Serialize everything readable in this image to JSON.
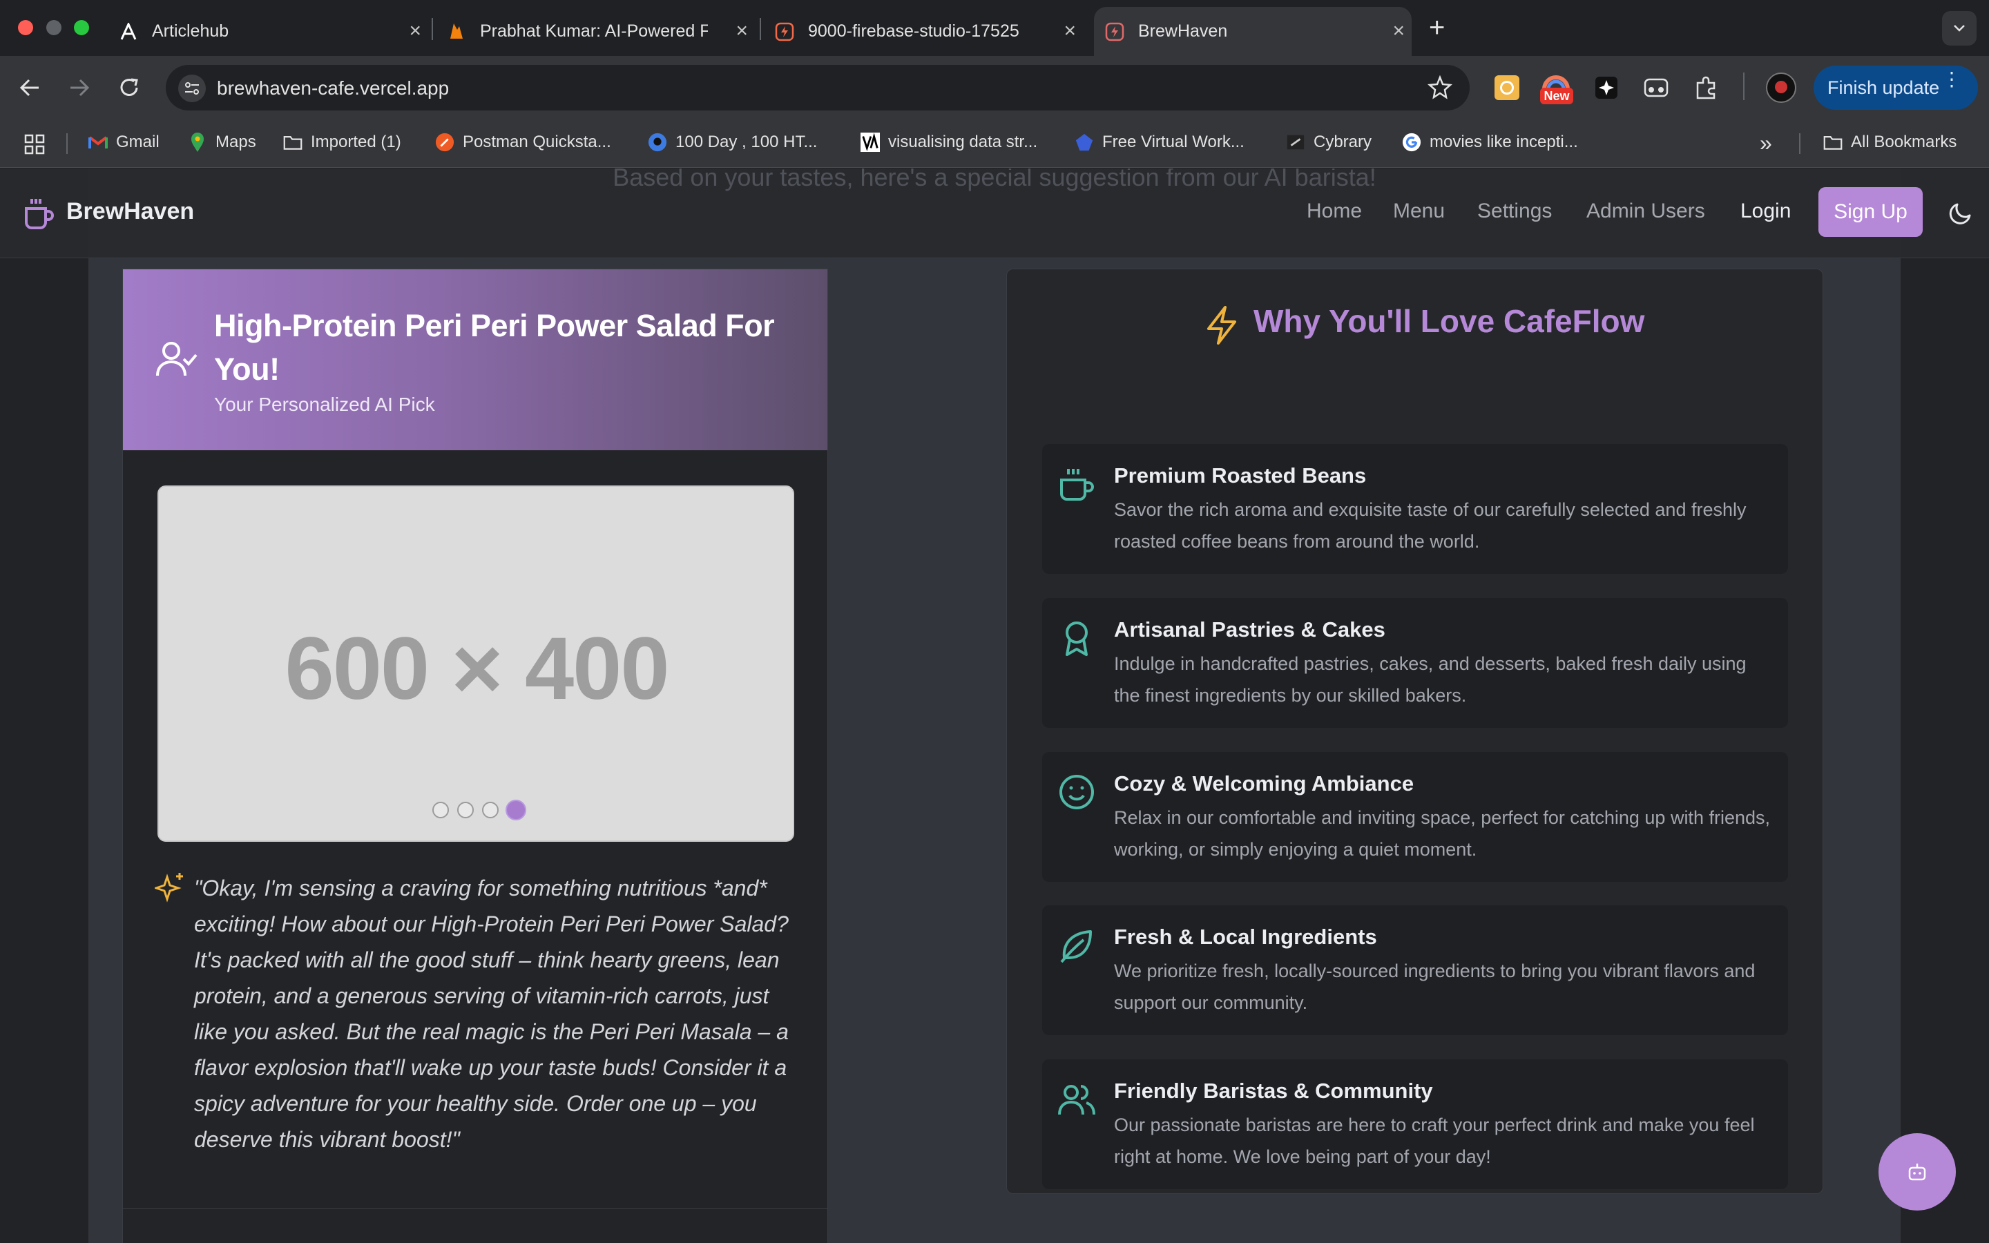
{
  "browser": {
    "tabs": [
      {
        "title": "Articlehub"
      },
      {
        "title": "Prabhat Kumar: AI-Powered F"
      },
      {
        "title": "9000-firebase-studio-17525"
      },
      {
        "title": "BrewHaven"
      }
    ],
    "address": "brewhaven-cafe.vercel.app",
    "new_badge": "New",
    "finish_update": "Finish update",
    "bookmarks": [
      {
        "label": "Gmail"
      },
      {
        "label": "Maps"
      },
      {
        "label": "Imported (1)"
      },
      {
        "label": "Postman Quicksta..."
      },
      {
        "label": "100 Day , 100 HT..."
      },
      {
        "label": "visualising data str..."
      },
      {
        "label": "Free Virtual Work..."
      },
      {
        "label": "Cybrary"
      },
      {
        "label": "movies like incepti..."
      }
    ],
    "all_bookmarks": "All Bookmarks"
  },
  "site": {
    "brand": "BrewHaven",
    "nav": [
      "Home",
      "Menu",
      "Settings",
      "Admin Users"
    ],
    "login": "Login",
    "signup": "Sign Up",
    "ghost_text": "Based on your tastes, here's a special suggestion from our AI barista!",
    "accent": "#b688d8"
  },
  "recommendation": {
    "title": "High-Protein Peri Peri Power Salad For You!",
    "subtitle": "Your Personalized AI Pick",
    "image_placeholder": "600 × 400",
    "carousel": {
      "total": 4,
      "active": 4
    },
    "quote": "\"Okay, I'm sensing a craving for something nutritious *and* exciting! How about our High-Protein Peri Peri Power Salad? It's packed with all the good stuff – think hearty greens, lean protein, and a generous serving of vitamin-rich carrots, just like you asked. But the real magic is the Peri Peri Masala – a flavor explosion that'll wake up your taste buds! Consider it a spicy adventure for your healthy side. Order one up – you deserve this vibrant boost!\""
  },
  "why": {
    "title": "Why You'll Love CafeFlow",
    "features": [
      {
        "icon": "coffee-cup-icon",
        "title": "Premium Roasted Beans",
        "desc": "Savor the rich aroma and exquisite taste of our carefully selected and freshly roasted coffee beans from around the world."
      },
      {
        "icon": "award-icon",
        "title": "Artisanal Pastries & Cakes",
        "desc": "Indulge in handcrafted pastries, cakes, and desserts, baked fresh daily using the finest ingredients by our skilled bakers."
      },
      {
        "icon": "smile-icon",
        "title": "Cozy & Welcoming Ambiance",
        "desc": "Relax in our comfortable and inviting space, perfect for catching up with friends, working, or simply enjoying a quiet moment."
      },
      {
        "icon": "leaf-icon",
        "title": "Fresh & Local Ingredients",
        "desc": "We prioritize fresh, locally-sourced ingredients to bring you vibrant flavors and support our community."
      },
      {
        "icon": "users-icon",
        "title": "Friendly Baristas & Community",
        "desc": "Our passionate baristas are here to craft your perfect drink and make you feel right at home. We love being part of your day!"
      }
    ]
  }
}
